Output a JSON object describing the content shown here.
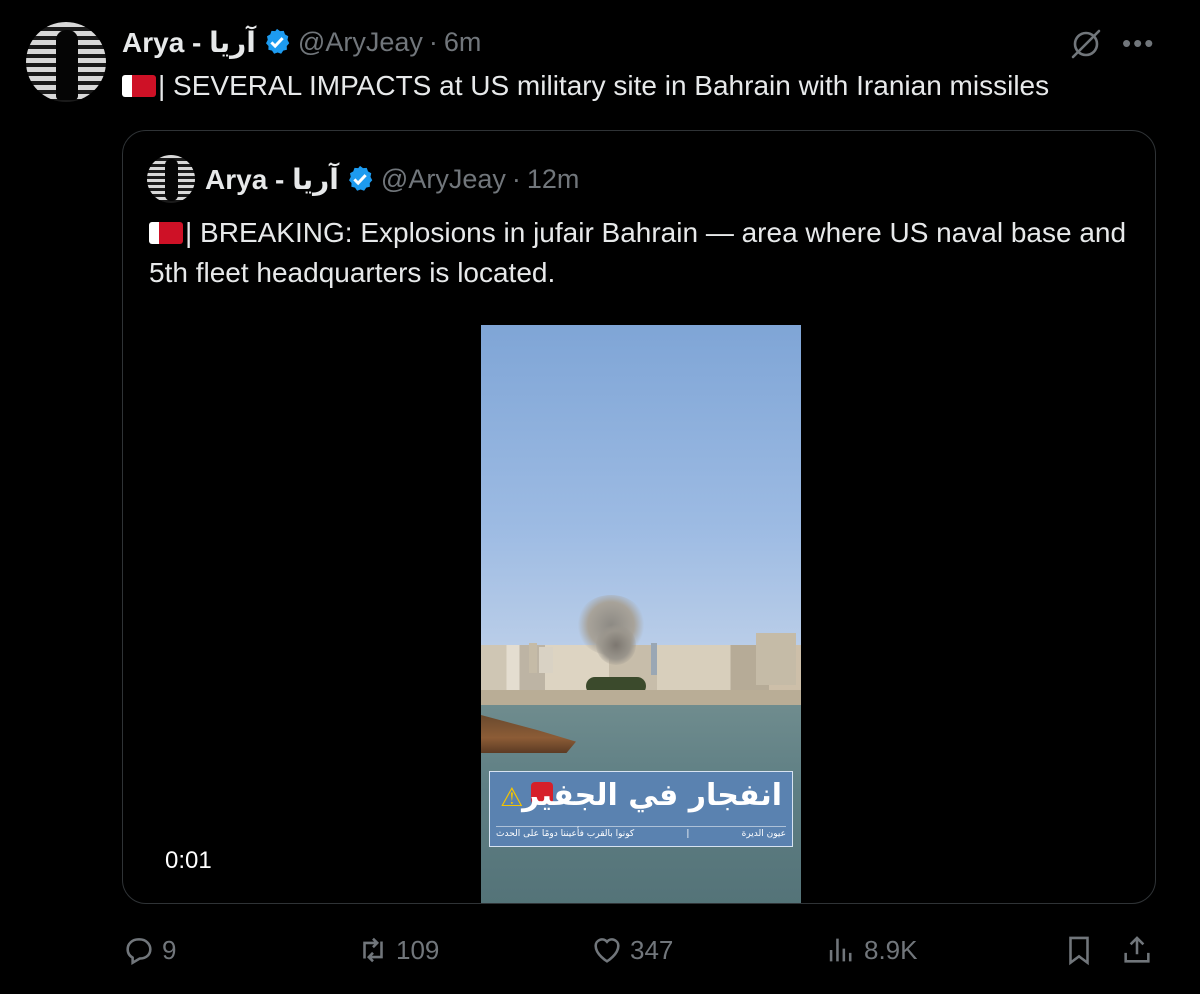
{
  "tweet": {
    "author_name": "Arya - آریا",
    "handle": "@AryJeay",
    "separator": "·",
    "time": "6m",
    "flag_icon": "bahrain-flag-icon",
    "text": "| SEVERAL IMPACTS at US military site in Bahrain with Iranian missiles",
    "more_label": "•••"
  },
  "quote": {
    "author_name": "Arya - آریا",
    "handle": "@AryJeay",
    "separator": "·",
    "time": "12m",
    "text": "| BREAKING: Explosions in jufair Bahrain — area where US naval base and 5th fleet headquarters is located.",
    "video": {
      "banner_title": "انفجار في الجفير",
      "banner_sub_left": "كونوا بالقرب فأعيننا دومًا على الحدث",
      "banner_sub_divider": "|",
      "banner_sub_right": "عيون الديرة",
      "timestamp": "0:01"
    }
  },
  "actions": {
    "replies": "9",
    "reposts": "109",
    "likes": "347",
    "views": "8.9K"
  },
  "colors": {
    "background": "#000000",
    "text": "#e7e9ea",
    "muted": "#71767b",
    "verified": "#1d9bf0",
    "border": "#2f3336"
  }
}
